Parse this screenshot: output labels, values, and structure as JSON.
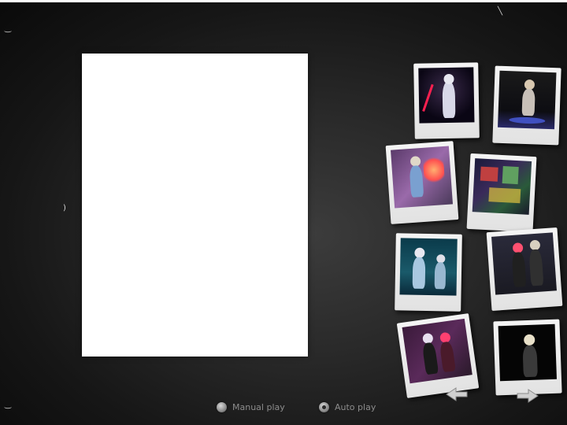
{
  "accent_color": "#ffffff",
  "background_color": "#1a1a1a",
  "controls": {
    "manual_play_label": "Manual play",
    "auto_play_label": "Auto play",
    "selected": "auto"
  },
  "thumbnails": [
    {
      "id": "thumb-1"
    },
    {
      "id": "thumb-2"
    },
    {
      "id": "thumb-3"
    },
    {
      "id": "thumb-4"
    },
    {
      "id": "thumb-5"
    },
    {
      "id": "thumb-6"
    },
    {
      "id": "thumb-7"
    },
    {
      "id": "thumb-8"
    }
  ],
  "nav": {
    "prev_icon": "arrow-left-icon",
    "next_icon": "arrow-right-icon"
  }
}
